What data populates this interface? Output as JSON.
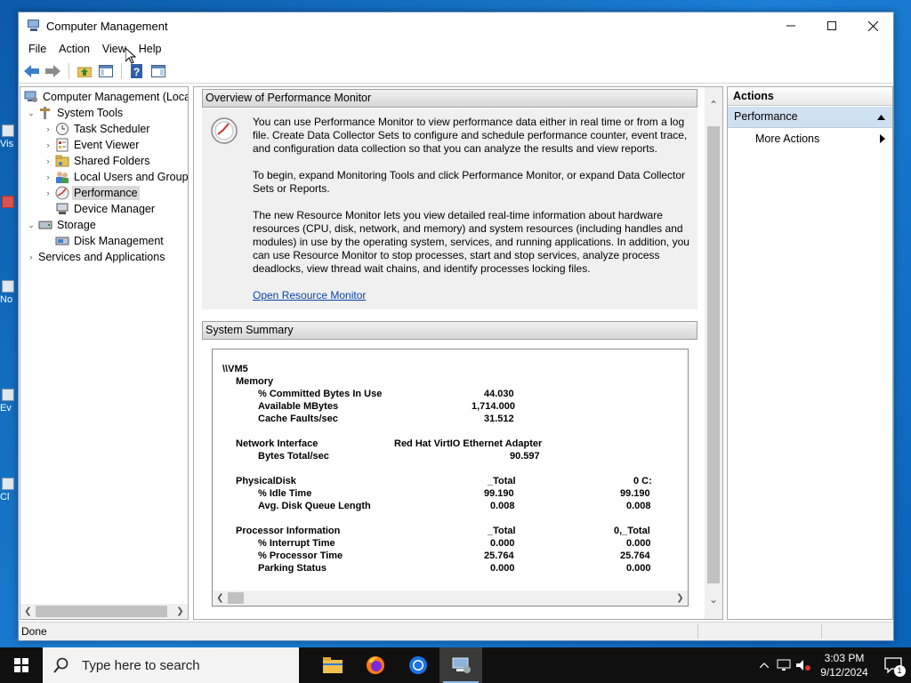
{
  "desktop": {
    "icons": [
      {
        "label": "Vis"
      },
      {
        "label": ""
      },
      {
        "label": "No"
      },
      {
        "label": "Ev"
      },
      {
        "label": "Cl"
      }
    ]
  },
  "window": {
    "title": "Computer Management",
    "menu": [
      "File",
      "Action",
      "View",
      "Help"
    ]
  },
  "tree": {
    "items": [
      {
        "label": "Computer Management (Local",
        "icon": "computer-management-icon"
      },
      {
        "label": "System Tools",
        "icon": "system-tools-icon"
      },
      {
        "label": "Task Scheduler",
        "icon": "clock-icon"
      },
      {
        "label": "Event Viewer",
        "icon": "event-viewer-icon"
      },
      {
        "label": "Shared Folders",
        "icon": "shared-folder-icon"
      },
      {
        "label": "Local Users and Groups",
        "icon": "users-icon"
      },
      {
        "label": "Performance",
        "icon": "performance-icon"
      },
      {
        "label": "Device Manager",
        "icon": "device-manager-icon"
      },
      {
        "label": "Storage",
        "icon": "storage-icon"
      },
      {
        "label": "Disk Management",
        "icon": "disk-icon"
      },
      {
        "label": "Services and Applications",
        "icon": "services-icon"
      }
    ]
  },
  "overview": {
    "header": "Overview of Performance Monitor",
    "para1": "You can use Performance Monitor to view performance data either in real time or from a log file. Create Data Collector Sets to configure and schedule performance counter, event trace, and configuration data collection so that you can analyze the results and view reports.",
    "para2": "To begin, expand Monitoring Tools and click Performance Monitor, or expand Data Collector Sets or Reports.",
    "para3": "The new Resource Monitor lets you view detailed real-time information about hardware resources (CPU, disk, network, and memory) and system resources (including handles and modules) in use by the operating system, services, and running applications. In addition, you can use Resource Monitor to stop processes, start and stop services, analyze process deadlocks, view thread wait chains, and identify processes locking files.",
    "link": "Open Resource Monitor"
  },
  "summary": {
    "header": "System Summary",
    "machine": "\\\\VM5",
    "memory": {
      "label": "Memory",
      "rows": [
        {
          "name": "% Committed Bytes In Use",
          "value": "44.030"
        },
        {
          "name": "Available MBytes",
          "value": "1,714.000"
        },
        {
          "name": "Cache Faults/sec",
          "value": "31.512"
        }
      ]
    },
    "network": {
      "label": "Network Interface",
      "adapter": "Red Hat VirtIO Ethernet Adapter",
      "rows": [
        {
          "name": "Bytes Total/sec",
          "value": "90.597"
        }
      ]
    },
    "disk": {
      "label": "PhysicalDisk",
      "col1": "_Total",
      "col2": "0 C:",
      "rows": [
        {
          "name": "% Idle Time",
          "v1": "99.190",
          "v2": "99.190"
        },
        {
          "name": "Avg. Disk Queue Length",
          "v1": "0.008",
          "v2": "0.008"
        }
      ]
    },
    "processor": {
      "label": "Processor Information",
      "col1": "_Total",
      "col2": "0,_Total",
      "rows": [
        {
          "name": "% Interrupt Time",
          "v1": "0.000",
          "v2": "0.000"
        },
        {
          "name": "% Processor Time",
          "v1": "25.764",
          "v2": "25.764"
        },
        {
          "name": "Parking Status",
          "v1": "0.000",
          "v2": "0.000"
        }
      ]
    }
  },
  "actions": {
    "header": "Actions",
    "section": "Performance",
    "items": [
      "More Actions"
    ]
  },
  "status": {
    "text": "Done"
  },
  "taskbar": {
    "search_placeholder": "Type here to search",
    "time": "3:03 PM",
    "date": "9/12/2024",
    "notification_count": "1"
  }
}
